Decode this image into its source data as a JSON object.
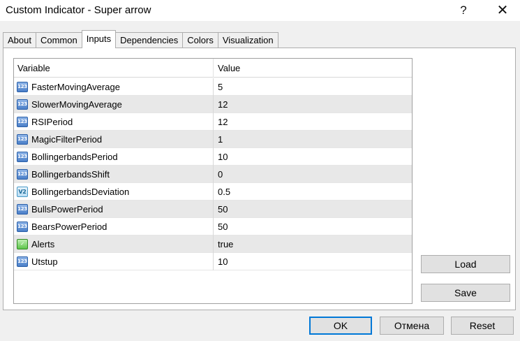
{
  "window": {
    "title": "Custom Indicator - Super arrow",
    "help_glyph": "?",
    "close_glyph": "✕"
  },
  "tabs": [
    {
      "label": "About",
      "active": false
    },
    {
      "label": "Common",
      "active": false
    },
    {
      "label": "Inputs",
      "active": true
    },
    {
      "label": "Dependencies",
      "active": false
    },
    {
      "label": "Colors",
      "active": false
    },
    {
      "label": "Visualization",
      "active": false
    }
  ],
  "table": {
    "headers": {
      "variable": "Variable",
      "value": "Value"
    },
    "rows": [
      {
        "icon": "int-icon",
        "icon_text": "123",
        "variable": "FasterMovingAverage",
        "value": "5"
      },
      {
        "icon": "int-icon",
        "icon_text": "123",
        "variable": "SlowerMovingAverage",
        "value": "12"
      },
      {
        "icon": "int-icon",
        "icon_text": "123",
        "variable": "RSIPeriod",
        "value": "12"
      },
      {
        "icon": "int-icon",
        "icon_text": "123",
        "variable": "MagicFilterPeriod",
        "value": "1"
      },
      {
        "icon": "int-icon",
        "icon_text": "123",
        "variable": "BollingerbandsPeriod",
        "value": "10"
      },
      {
        "icon": "int-icon",
        "icon_text": "123",
        "variable": "BollingerbandsShift",
        "value": "0"
      },
      {
        "icon": "double-icon",
        "icon_text": "V2",
        "variable": "BollingerbandsDeviation",
        "value": "0.5"
      },
      {
        "icon": "int-icon",
        "icon_text": "123",
        "variable": "BullsPowerPeriod",
        "value": "50"
      },
      {
        "icon": "int-icon",
        "icon_text": "123",
        "variable": "BearsPowerPeriod",
        "value": "50"
      },
      {
        "icon": "bool-icon",
        "icon_text": "✓",
        "variable": "Alerts",
        "value": "true"
      },
      {
        "icon": "int-icon",
        "icon_text": "123",
        "variable": "Utstup",
        "value": "10"
      }
    ]
  },
  "buttons": {
    "load": "Load",
    "save": "Save",
    "ok": "OK",
    "cancel": "Отмена",
    "reset": "Reset"
  },
  "colors": {
    "accent": "#0078d7",
    "row_alt": "#e8e8e8",
    "int_icon": "#4b7fc8",
    "bool_icon": "#5cc44a"
  }
}
